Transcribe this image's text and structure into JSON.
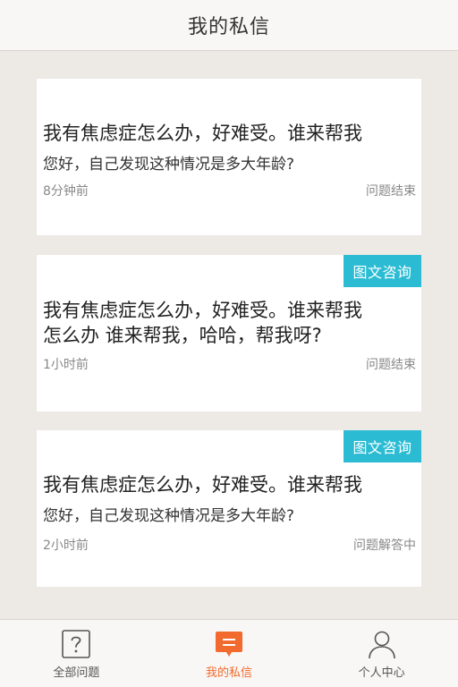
{
  "header": {
    "title": "我的私信"
  },
  "cards": [
    {
      "tag": "",
      "title": "我有焦虑症怎么办，好难受。谁来帮我",
      "subtitle": "您好，自己发现这种情况是多大年龄?",
      "time": "8分钟前",
      "status": "问题结束"
    },
    {
      "tag": "图文咨询",
      "title": "我有焦虑症怎么办，好难受。谁来帮我",
      "subtitle": "怎么办 谁来帮我，哈哈，帮我呀?",
      "time": "1小时前",
      "status": "问题结束"
    },
    {
      "tag": "图文咨询",
      "title": "我有焦虑症怎么办，好难受。谁来帮我",
      "subtitle": "您好，自己发现这种情况是多大年龄?",
      "time": "2小时前",
      "status": "问题解答中"
    }
  ],
  "tabbar": {
    "items": [
      {
        "label": "全部问题",
        "icon": "question-icon",
        "active": false
      },
      {
        "label": "我的私信",
        "icon": "message-icon",
        "active": true
      },
      {
        "label": "个人中心",
        "icon": "person-icon",
        "active": false
      }
    ],
    "active_color": "#f26a2e"
  },
  "colors": {
    "tag": "#2bbcd4",
    "background": "#edeae5"
  }
}
